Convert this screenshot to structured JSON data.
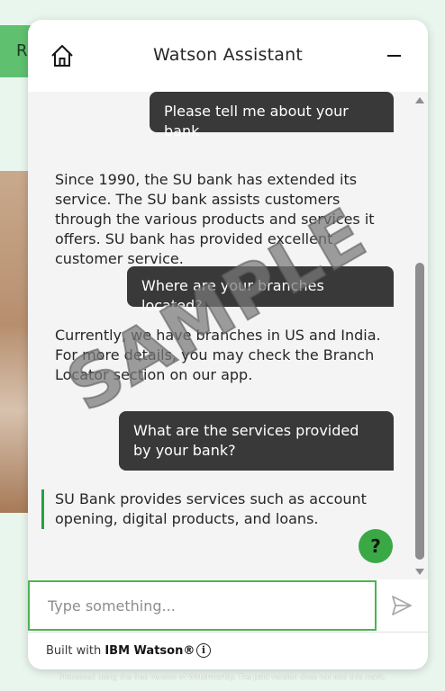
{
  "background": {
    "pill_text": "R"
  },
  "header": {
    "title": "Watson Assistant",
    "home_icon": "home-icon",
    "minimize_icon": "minimize-icon"
  },
  "messages": [
    {
      "role": "user",
      "text": "Please tell me about your bank"
    },
    {
      "role": "bot",
      "text": "Since 1990, the SU bank has extended its service. The SU bank assists customers through the various products and services it offers. SU bank has provided excellent customer service."
    },
    {
      "role": "user",
      "text": "Where are your branches located?"
    },
    {
      "role": "bot",
      "text": "Currently, we have branches in US and India. For more details, you may check the Branch Locator section on our app."
    },
    {
      "role": "user",
      "text": "What are the services provided by your bank?"
    },
    {
      "role": "bot",
      "text": "SU Bank provides services such as account opening, digital products, and loans."
    }
  ],
  "help_button": {
    "label": "?"
  },
  "input": {
    "placeholder": "Type something...",
    "send_icon": "send-icon"
  },
  "footer": {
    "prefix": "Built with",
    "brand": "IBM Watson®",
    "info_icon": "info-icon",
    "info_label": "i"
  },
  "watermark": {
    "text": "SAMPLE",
    "footnote": "Processed using the free version of Watermarkly. The paid version does not add this mark."
  },
  "colors": {
    "accent": "#24a148",
    "help_button": "#3ba846",
    "user_bubble": "#393939",
    "chat_background": "#f4f4f4"
  }
}
